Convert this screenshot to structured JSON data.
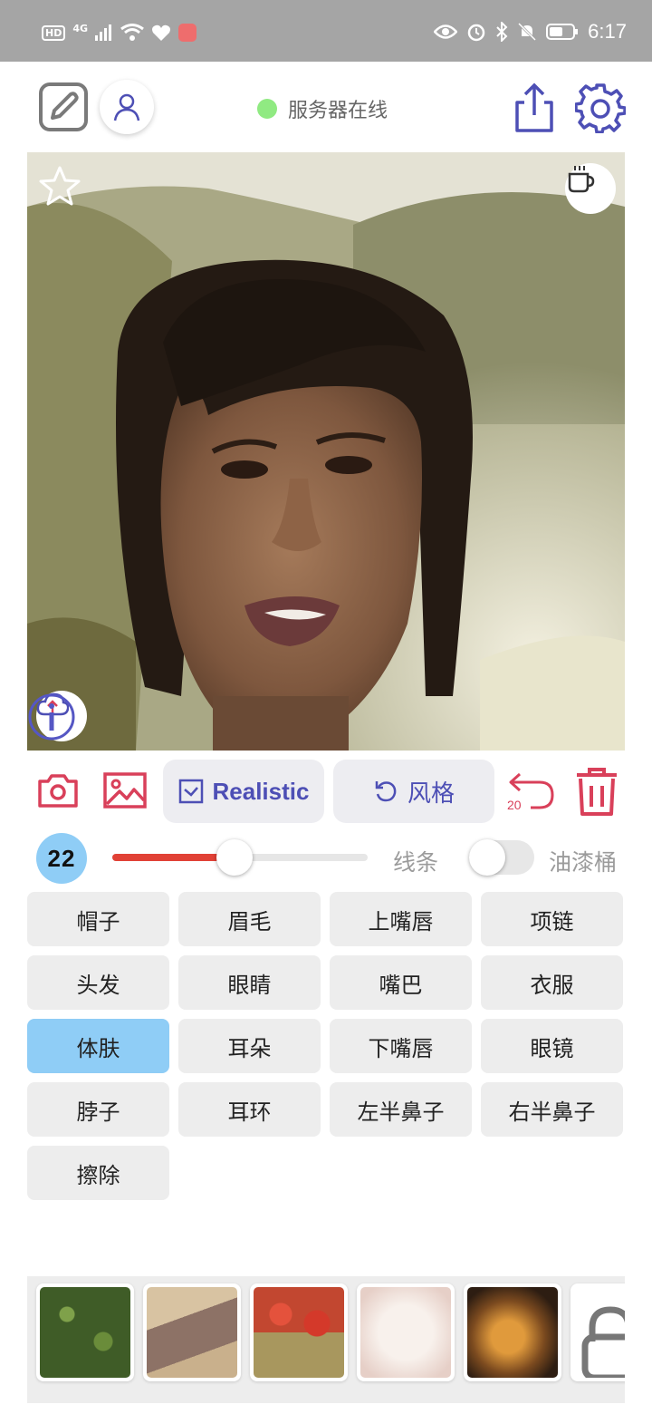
{
  "status_bar": {
    "left_badges": [
      "HD",
      "4G"
    ],
    "time": "6:17"
  },
  "header": {
    "server_status_text": "服务器在线",
    "server_status_color": "#90ea82"
  },
  "toolbar": {
    "style_mode_label": "Realistic",
    "style_button_label": "风格",
    "undo_count": "20"
  },
  "brush": {
    "size": "22",
    "size_fraction": 0.48,
    "line_label": "线条",
    "bucket_label": "油漆桶",
    "bucket_enabled": false
  },
  "categories": [
    {
      "label": "帽子",
      "selected": false
    },
    {
      "label": "眉毛",
      "selected": false
    },
    {
      "label": "上嘴唇",
      "selected": false
    },
    {
      "label": "项链",
      "selected": false
    },
    {
      "label": "头发",
      "selected": false
    },
    {
      "label": "眼睛",
      "selected": false
    },
    {
      "label": "嘴巴",
      "selected": false
    },
    {
      "label": "衣服",
      "selected": false
    },
    {
      "label": "体肤",
      "selected": true
    },
    {
      "label": "耳朵",
      "selected": false
    },
    {
      "label": "下嘴唇",
      "selected": false
    },
    {
      "label": "眼镜",
      "selected": false
    },
    {
      "label": "脖子",
      "selected": false
    },
    {
      "label": "耳环",
      "selected": false
    },
    {
      "label": "左半鼻子",
      "selected": false
    },
    {
      "label": "右半鼻子",
      "selected": false
    },
    {
      "label": "擦除",
      "selected": false
    }
  ],
  "textures": [
    {
      "name": "foliage-texture",
      "color": "#4c6b2e"
    },
    {
      "name": "stone-texture",
      "color": "#b49a7c"
    },
    {
      "name": "red-flowers-texture",
      "color": "#c9422c"
    },
    {
      "name": "pale-texture",
      "color": "#eedfd8"
    },
    {
      "name": "fire-texture",
      "color": "#a66424"
    },
    {
      "name": "locked-texture",
      "color": "#ffffff"
    }
  ],
  "colors": {
    "accent_blue": "#4d4fb5",
    "accent_red": "#d9405a",
    "selected_chip": "#8fcdf6"
  }
}
